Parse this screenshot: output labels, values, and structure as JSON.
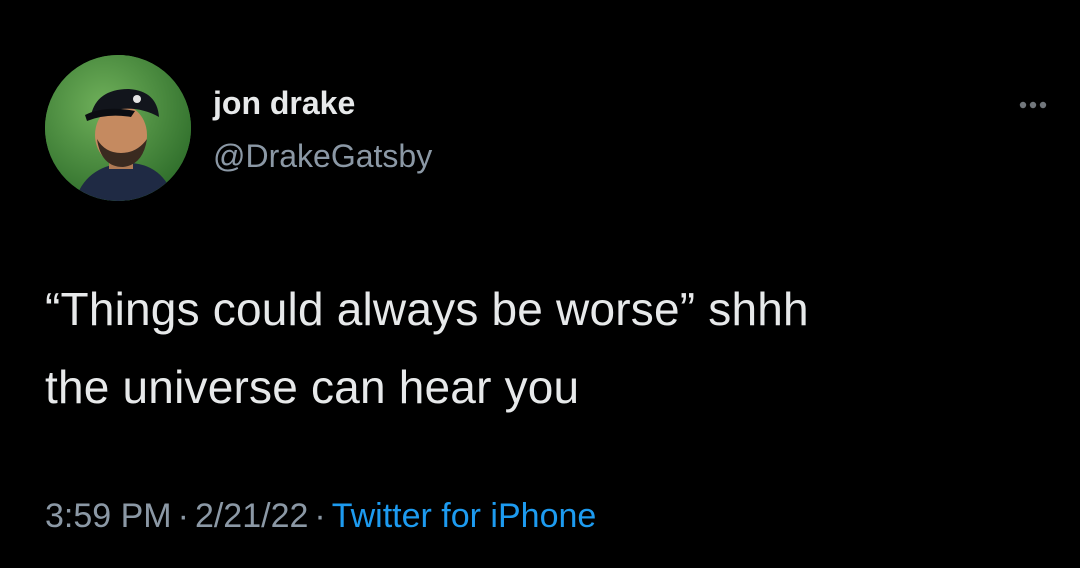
{
  "author": {
    "name": "jon drake",
    "handle": "@DrakeGatsby"
  },
  "tweet": {
    "line1": "“Things could always be worse” shhh",
    "line2": "the universe can hear you"
  },
  "meta": {
    "time": "3:59 PM",
    "separator": "·",
    "date": "2/21/22",
    "source": "Twitter for iPhone"
  },
  "colors": {
    "background": "#000000",
    "text": "#e7e9ea",
    "secondary": "#8b98a5",
    "accent": "#1d9bf0"
  },
  "icons": {
    "more": "more-horizontal-icon",
    "avatar": "profile-photo"
  }
}
